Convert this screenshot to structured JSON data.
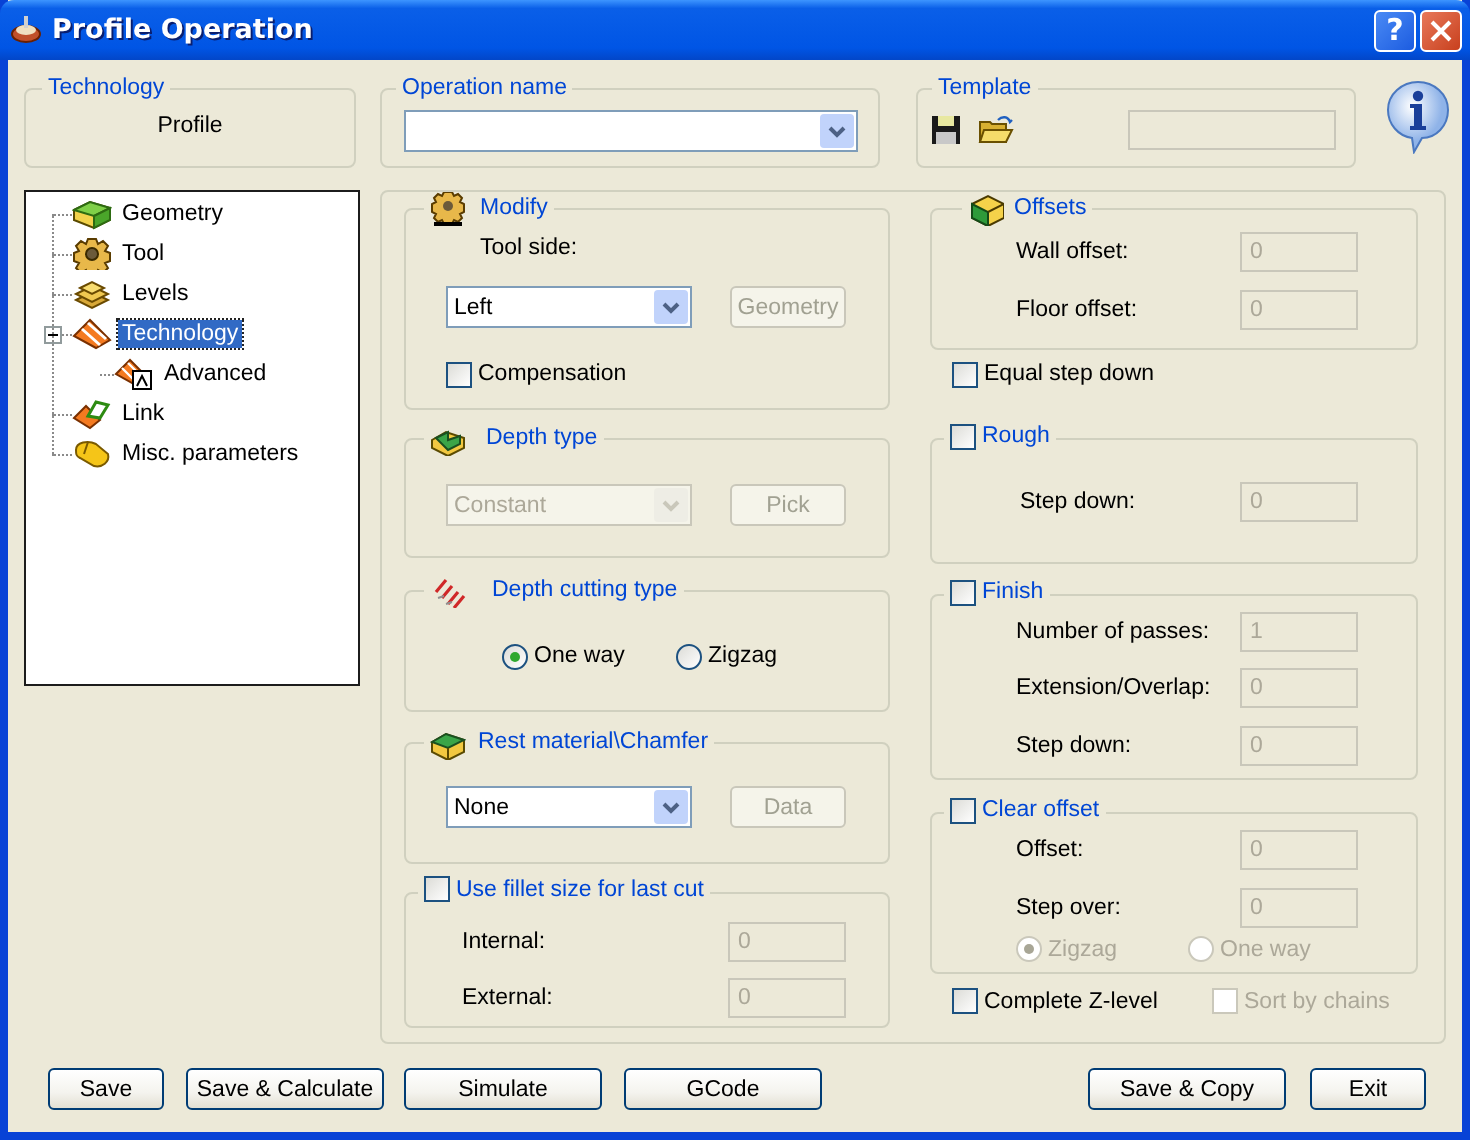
{
  "window": {
    "title": "Profile Operation",
    "help_button": "?"
  },
  "technology": {
    "title": "Technology",
    "value": "Profile"
  },
  "operation_name": {
    "title": "Operation name",
    "disabled": false
  },
  "template": {
    "title": "Template",
    "name_field": {
      "disabled": true
    }
  },
  "tree": [
    {
      "label": "Geometry",
      "kind": "geometry",
      "selected": false,
      "expanded": false
    },
    {
      "label": "Tool",
      "kind": "tool",
      "selected": false,
      "expanded": false
    },
    {
      "label": "Levels",
      "kind": "levels",
      "selected": false,
      "expanded": false
    },
    {
      "label": "Technology",
      "kind": "technology",
      "selected": true,
      "expanded": true,
      "children": [
        {
          "label": "Advanced",
          "kind": "advanced",
          "selected": false,
          "expanded": false
        }
      ]
    },
    {
      "label": "Link",
      "kind": "link",
      "selected": false,
      "expanded": false
    },
    {
      "label": "Misc. parameters",
      "kind": "misc",
      "selected": false,
      "expanded": false
    }
  ],
  "modify": {
    "title": "Modify",
    "tool_side_label": "Tool side:",
    "tool_side": {
      "value": "Left",
      "disabled": false
    },
    "geometry_button": {
      "label": "Geometry",
      "disabled": true
    },
    "compensation": {
      "label": "Compensation",
      "checked": false
    }
  },
  "depth_type": {
    "title": "Depth type",
    "value": "Constant",
    "disabled": true,
    "pick_button": {
      "label": "Pick",
      "disabled": true
    }
  },
  "depth_cutting_type": {
    "title": "Depth cutting type",
    "options": [
      {
        "label": "One way",
        "selected": true
      },
      {
        "label": "Zigzag",
        "selected": false
      }
    ]
  },
  "rest_material": {
    "title": "Rest material\\Chamfer",
    "value": "None",
    "disabled": false,
    "data_button": {
      "label": "Data",
      "disabled": true
    }
  },
  "fillet": {
    "label": "Use fillet size for last cut",
    "checked": false,
    "fields": [
      {
        "label": "Internal:",
        "value": "0",
        "disabled": true
      },
      {
        "label": "External:",
        "value": "0",
        "disabled": true
      }
    ]
  },
  "offsets": {
    "title": "Offsets",
    "fields": [
      {
        "label": "Wall offset:",
        "value": "0",
        "disabled": true
      },
      {
        "label": "Floor offset:",
        "value": "0",
        "disabled": true
      }
    ]
  },
  "equal_step_down": {
    "label": "Equal step down",
    "checked": false
  },
  "rough": {
    "label": "Rough",
    "checked": false,
    "fields": [
      {
        "label": "Step down:",
        "value": "0",
        "disabled": true
      }
    ]
  },
  "finish": {
    "label": "Finish",
    "checked": false,
    "fields": [
      {
        "label": "Number of passes:",
        "value": "1",
        "disabled": true
      },
      {
        "label": "Extension/Overlap:",
        "value": "0",
        "disabled": true
      },
      {
        "label": "Step down:",
        "value": "0",
        "disabled": true
      }
    ]
  },
  "clear_offset": {
    "label": "Clear offset",
    "checked": false,
    "fields": [
      {
        "label": "Offset:",
        "value": "0",
        "disabled": true
      },
      {
        "label": "Step over:",
        "value": "0",
        "disabled": true
      }
    ],
    "options": [
      {
        "label": "Zigzag",
        "selected": true,
        "disabled": true
      },
      {
        "label": "One way",
        "selected": false,
        "disabled": true
      }
    ]
  },
  "complete_z_level": {
    "label": "Complete Z-level",
    "checked": false
  },
  "sort_by_chains": {
    "label": "Sort by chains",
    "checked": false,
    "disabled": true
  },
  "buttons": [
    {
      "label": "Save"
    },
    {
      "label": "Save & Calculate"
    },
    {
      "label": "Simulate"
    },
    {
      "label": "GCode"
    },
    {
      "label": "Save & Copy"
    },
    {
      "label": "Exit"
    }
  ]
}
